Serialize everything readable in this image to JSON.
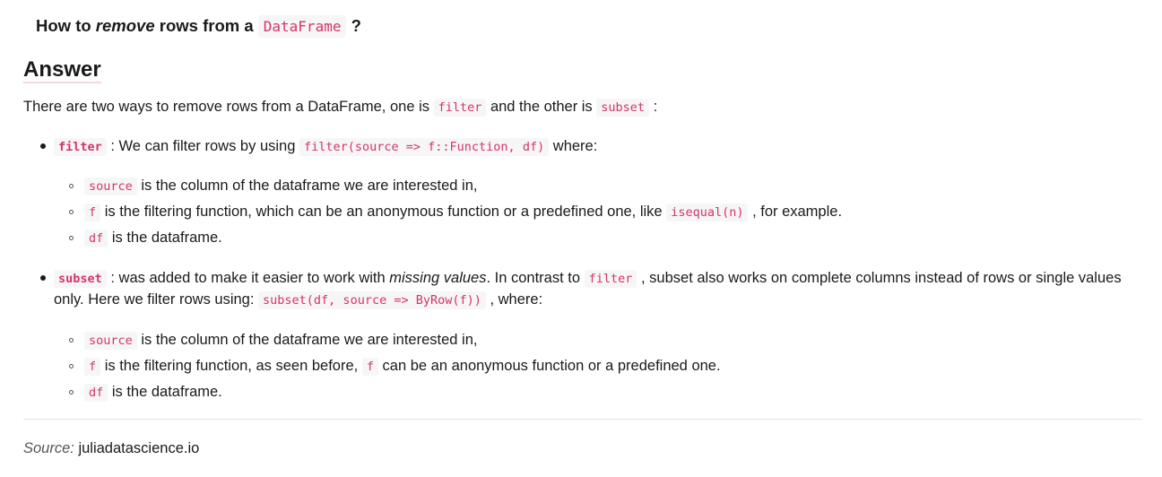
{
  "question": {
    "pre": "How to ",
    "em": "remove",
    "mid": " rows from a ",
    "code": "DataFrame",
    "post": " ?"
  },
  "answer_heading": "Answer",
  "intro": {
    "pre": "There are two ways to remove rows from a DataFrame, one is ",
    "code1": "filter",
    "mid": " and the other is ",
    "code2": "subset",
    "post": " :"
  },
  "filter_item": {
    "code": "filter",
    "pre": " : We can filter rows by using ",
    "code2": "filter(source => f::Function, df)",
    "post": " where:",
    "sub": [
      {
        "code": "source",
        "text": " is the column of the dataframe we are interested in,"
      },
      {
        "code": "f",
        "text": " is the filtering function, which can be an anonymous function or a predefined one, like ",
        "code2": "isequal(n)",
        "text2": " , for example."
      },
      {
        "code": "df",
        "text": " is the dataframe."
      }
    ]
  },
  "subset_item": {
    "code": "subset",
    "pre": " : was added to make it easier to work with ",
    "em": "missing values",
    "mid": ". In contrast to ",
    "code2": "filter",
    "post": " , subset also works on complete columns instead of rows or single values",
    "line2_pre": "only. Here we filter rows using: ",
    "line2_code": "subset(df, source => ByRow(f))",
    "line2_post": " , where:",
    "sub": [
      {
        "code": "source",
        "text": " is the column of the dataframe we are interested in,"
      },
      {
        "code": "f",
        "text": " is the filtering function, as seen before, ",
        "code2": "f",
        "text2": " can be an anonymous function or a predefined one."
      },
      {
        "code": "df",
        "text": " is the dataframe."
      }
    ]
  },
  "source": {
    "label": "Source:",
    "value": " juliadatascience.io"
  }
}
